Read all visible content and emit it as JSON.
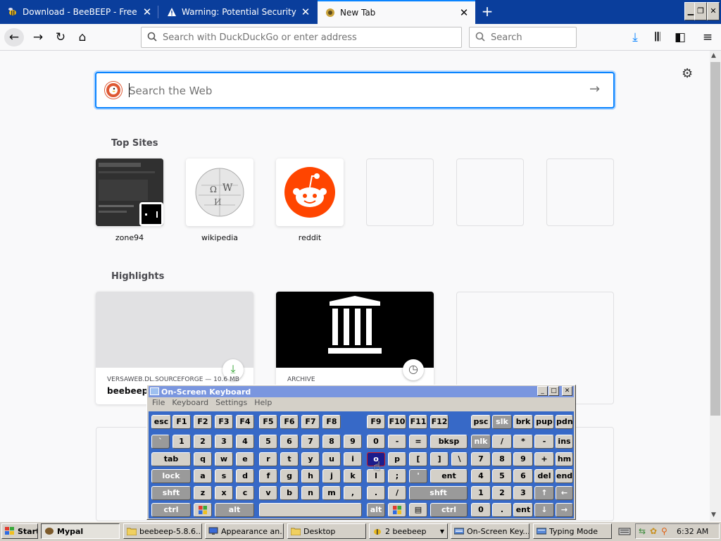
{
  "tabs": [
    {
      "title": "Download - BeeBEEP - Free Office",
      "icon": "bee-icon"
    },
    {
      "title": "Warning: Potential Security Risk A",
      "icon": "warning-icon"
    },
    {
      "title": "New Tab",
      "icon": "firefox-icon"
    }
  ],
  "urlbar": {
    "placeholder": "Search with DuckDuckGo or enter address"
  },
  "searchbar": {
    "placeholder": "Search"
  },
  "websearch": {
    "placeholder": "Search the Web"
  },
  "top_sites": {
    "title": "Top Sites",
    "sites": [
      {
        "label": "zone94"
      },
      {
        "label": "wikipedia"
      },
      {
        "label": "reddit"
      }
    ]
  },
  "highlights": {
    "title": "Highlights",
    "cards": [
      {
        "source": "VERSAWEB.DL.SOURCEFORGE — 10.6 MB",
        "title": "beebeep-"
      },
      {
        "source": "ARCHIVE",
        "title": ""
      }
    ]
  },
  "osk": {
    "title": "On-Screen Keyboard",
    "menu": [
      "File",
      "Keyboard",
      "Settings",
      "Help"
    ]
  },
  "taskbar": {
    "start": "Start",
    "items": [
      "Mypal",
      "beebeep-5.8.6...",
      "Appearance an...",
      "Desktop",
      "2 beebeep",
      "On-Screen Key...",
      "Typing Mode"
    ],
    "clock": "6:32 AM"
  },
  "colors": {
    "accent": "#0a84ff",
    "tabstrip": "#0a3e9c",
    "osk_bg": "#3769c7"
  }
}
